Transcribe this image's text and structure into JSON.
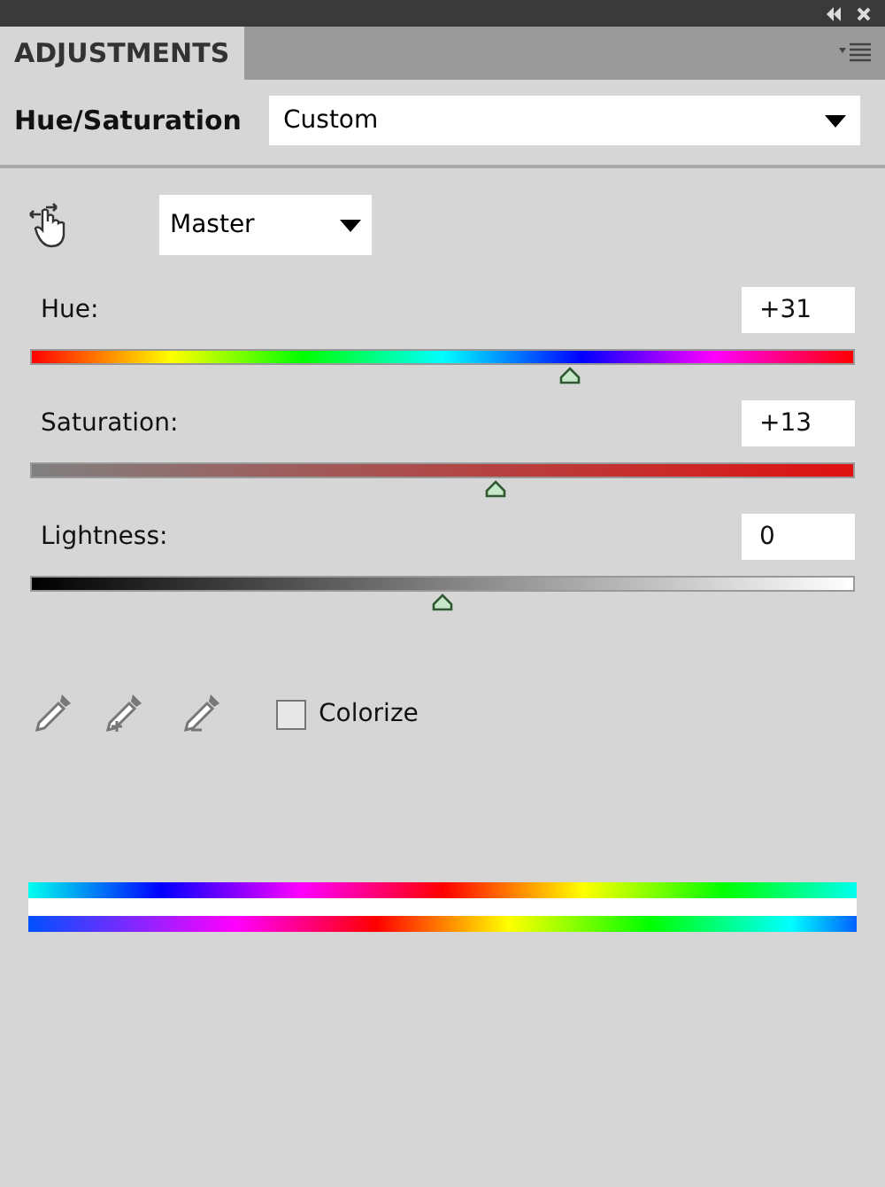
{
  "panel": {
    "tab": "ADJUSTMENTS"
  },
  "header": {
    "title": "Hue/Saturation",
    "preset": "Custom"
  },
  "channel": "Master",
  "sliders": [
    {
      "kind": "hue",
      "label": "Hue:",
      "value": "+31",
      "level": 0.655
    },
    {
      "kind": "saturation",
      "label": "Saturation:",
      "value": "+13",
      "level": 0.565
    },
    {
      "kind": "lightness",
      "label": "Lightness:",
      "value": "0",
      "level": 0.5
    }
  ],
  "colorize": {
    "label": "Colorize",
    "checked": false
  }
}
